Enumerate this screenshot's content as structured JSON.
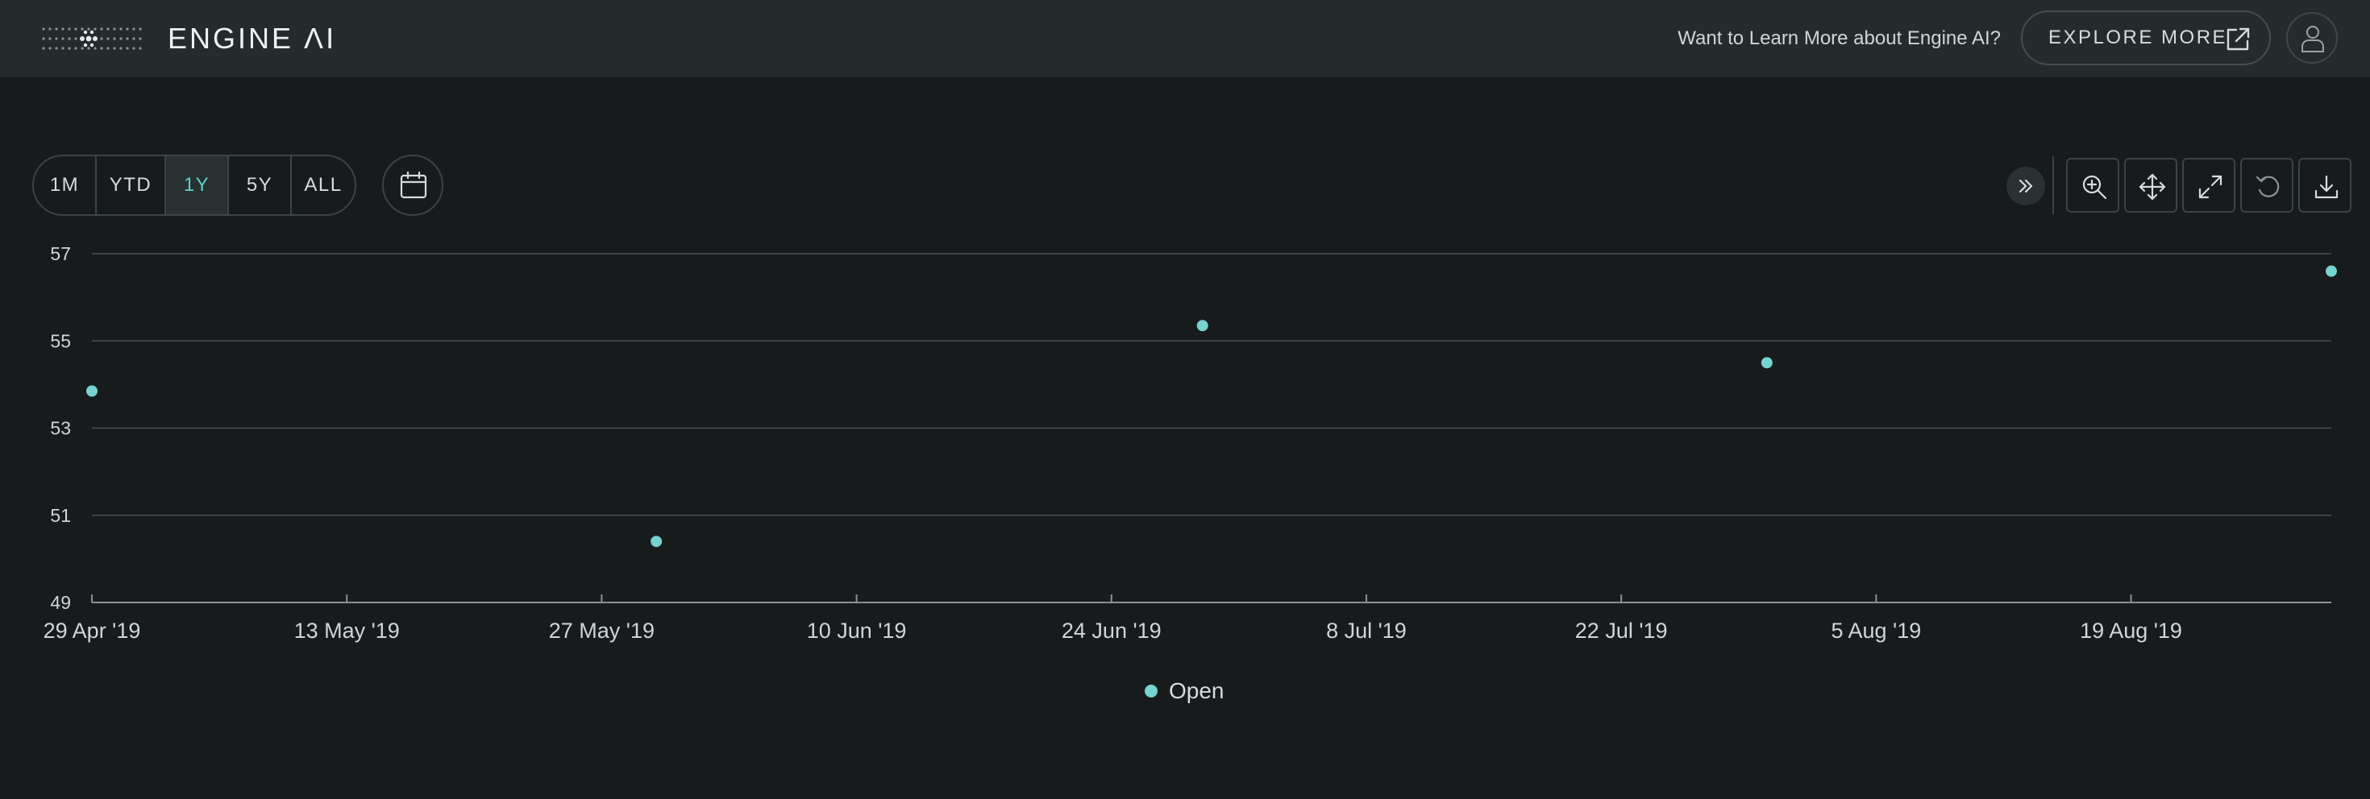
{
  "header": {
    "brand": "ENGINE ΛI",
    "promo_text": "Want to Learn More about Engine AI?",
    "explore_label": "EXPLORE MORE"
  },
  "icons": {
    "logo": "dot-grid-logo-icon",
    "explore": "external-link-icon",
    "avatar": "user-icon",
    "calendar": "calendar-icon",
    "collapse": "double-chevron-right-icon",
    "tools": [
      "zoom-in-icon",
      "pan-move-icon",
      "expand-icon",
      "reset-icon",
      "download-icon"
    ]
  },
  "range_selector": {
    "options": [
      "1M",
      "YTD",
      "1Y",
      "5Y",
      "ALL"
    ],
    "selected": "1Y"
  },
  "colors": {
    "accent": "#5ad1cc",
    "series": "#75d3d2",
    "background": "#171b1c",
    "header": "#252b2c"
  },
  "chart_data": {
    "type": "scatter",
    "y_ticks": [
      "57",
      "55",
      "53",
      "51",
      "49"
    ],
    "ylim": [
      49,
      57
    ],
    "xlim": [
      "2019-04-29",
      "2019-08-30"
    ],
    "x_ticks": [
      {
        "date": "2019-04-29",
        "label": "29 Apr '19"
      },
      {
        "date": "2019-05-13",
        "label": "13 May '19"
      },
      {
        "date": "2019-05-27",
        "label": "27 May '19"
      },
      {
        "date": "2019-06-10",
        "label": "10 Jun '19"
      },
      {
        "date": "2019-06-24",
        "label": "24 Jun '19"
      },
      {
        "date": "2019-07-08",
        "label": "8 Jul '19"
      },
      {
        "date": "2019-07-22",
        "label": "22 Jul '19"
      },
      {
        "date": "2019-08-05",
        "label": "5 Aug '19"
      },
      {
        "date": "2019-08-19",
        "label": "19 Aug '19"
      }
    ],
    "series": [
      {
        "name": "Open",
        "points": [
          {
            "x": "2019-04-29",
            "y": 53.85
          },
          {
            "x": "2019-05-30",
            "y": 50.4
          },
          {
            "x": "2019-06-29",
            "y": 55.35
          },
          {
            "x": "2019-07-30",
            "y": 54.5
          },
          {
            "x": "2019-08-30",
            "y": 56.6
          }
        ]
      }
    ],
    "grid": true,
    "legend": "bottom-center"
  }
}
